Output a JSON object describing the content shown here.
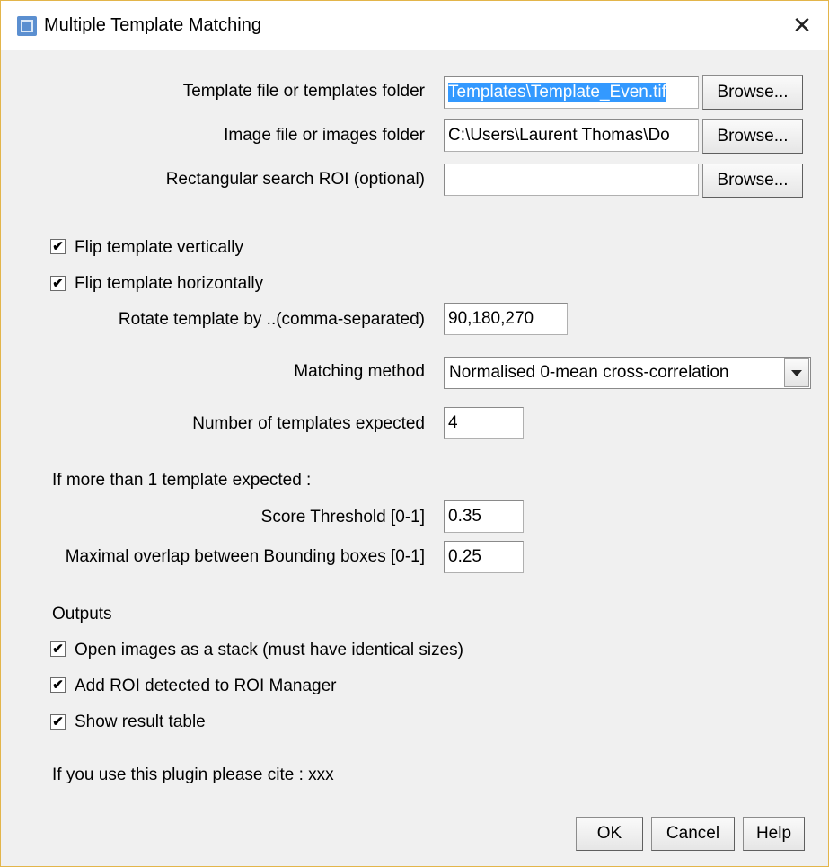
{
  "window": {
    "title": "Multiple Template Matching",
    "close_symbol": "✕"
  },
  "fields": {
    "template_label": "Template file or templates folder",
    "template_value": "Templates\\Template_Even.tif",
    "image_label": "Image file or images folder",
    "image_value": "C:\\Users\\Laurent Thomas\\Do",
    "roi_label": "Rectangular search ROI (optional)",
    "roi_value": "",
    "browse_label": "Browse..."
  },
  "flip": {
    "vertical_label": "Flip template vertically",
    "vertical_checked": true,
    "horizontal_label": "Flip template horizontally",
    "horizontal_checked": true
  },
  "rotate": {
    "label": "Rotate template by ..(comma-separated)",
    "value": "90,180,270"
  },
  "matching": {
    "label": "Matching method",
    "selected": "Normalised 0-mean cross-correlation"
  },
  "templates_expected": {
    "label": "Number of templates expected",
    "value": "4"
  },
  "multi": {
    "heading": "If more than 1 template expected :",
    "score_label": "Score Threshold [0-1]",
    "score_value": "0.35",
    "overlap_label": "Maximal overlap between Bounding boxes [0-1]",
    "overlap_value": "0.25"
  },
  "outputs": {
    "heading": "Outputs",
    "stack_label": "Open images as a stack (must have identical sizes)",
    "stack_checked": true,
    "roi_label": "Add ROI detected  to ROI Manager",
    "roi_checked": true,
    "table_label": "Show result table",
    "table_checked": true
  },
  "cite": "If you use this plugin please cite : xxx",
  "buttons": {
    "ok": "OK",
    "cancel": "Cancel",
    "help": "Help"
  },
  "check_mark": "✔"
}
